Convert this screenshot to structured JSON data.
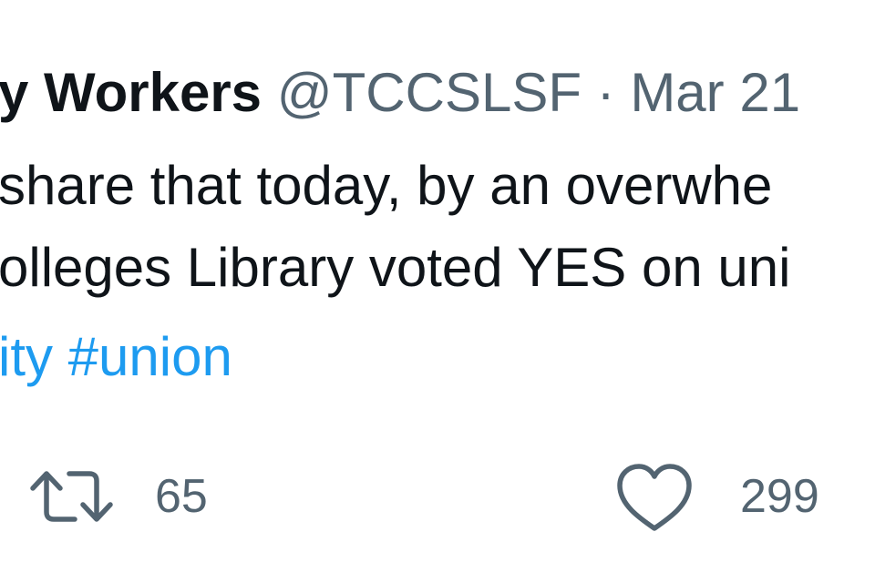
{
  "tweet": {
    "author_name": "y Workers",
    "handle": "@TCCSLSF",
    "separator": "·",
    "date": "Mar 21",
    "text_line_1": "share that today, by an overwhe",
    "text_line_2": "olleges Library voted YES on uni",
    "hashtag_1": "ity",
    "hashtag_2": "#union"
  },
  "actions": {
    "retweet_icon": "retweet-icon",
    "retweet_count": "65",
    "like_icon": "heart-icon",
    "like_count": "299"
  },
  "colors": {
    "text": "#0f1419",
    "secondary": "#536471",
    "link": "#1d9bf0",
    "background": "#ffffff"
  }
}
